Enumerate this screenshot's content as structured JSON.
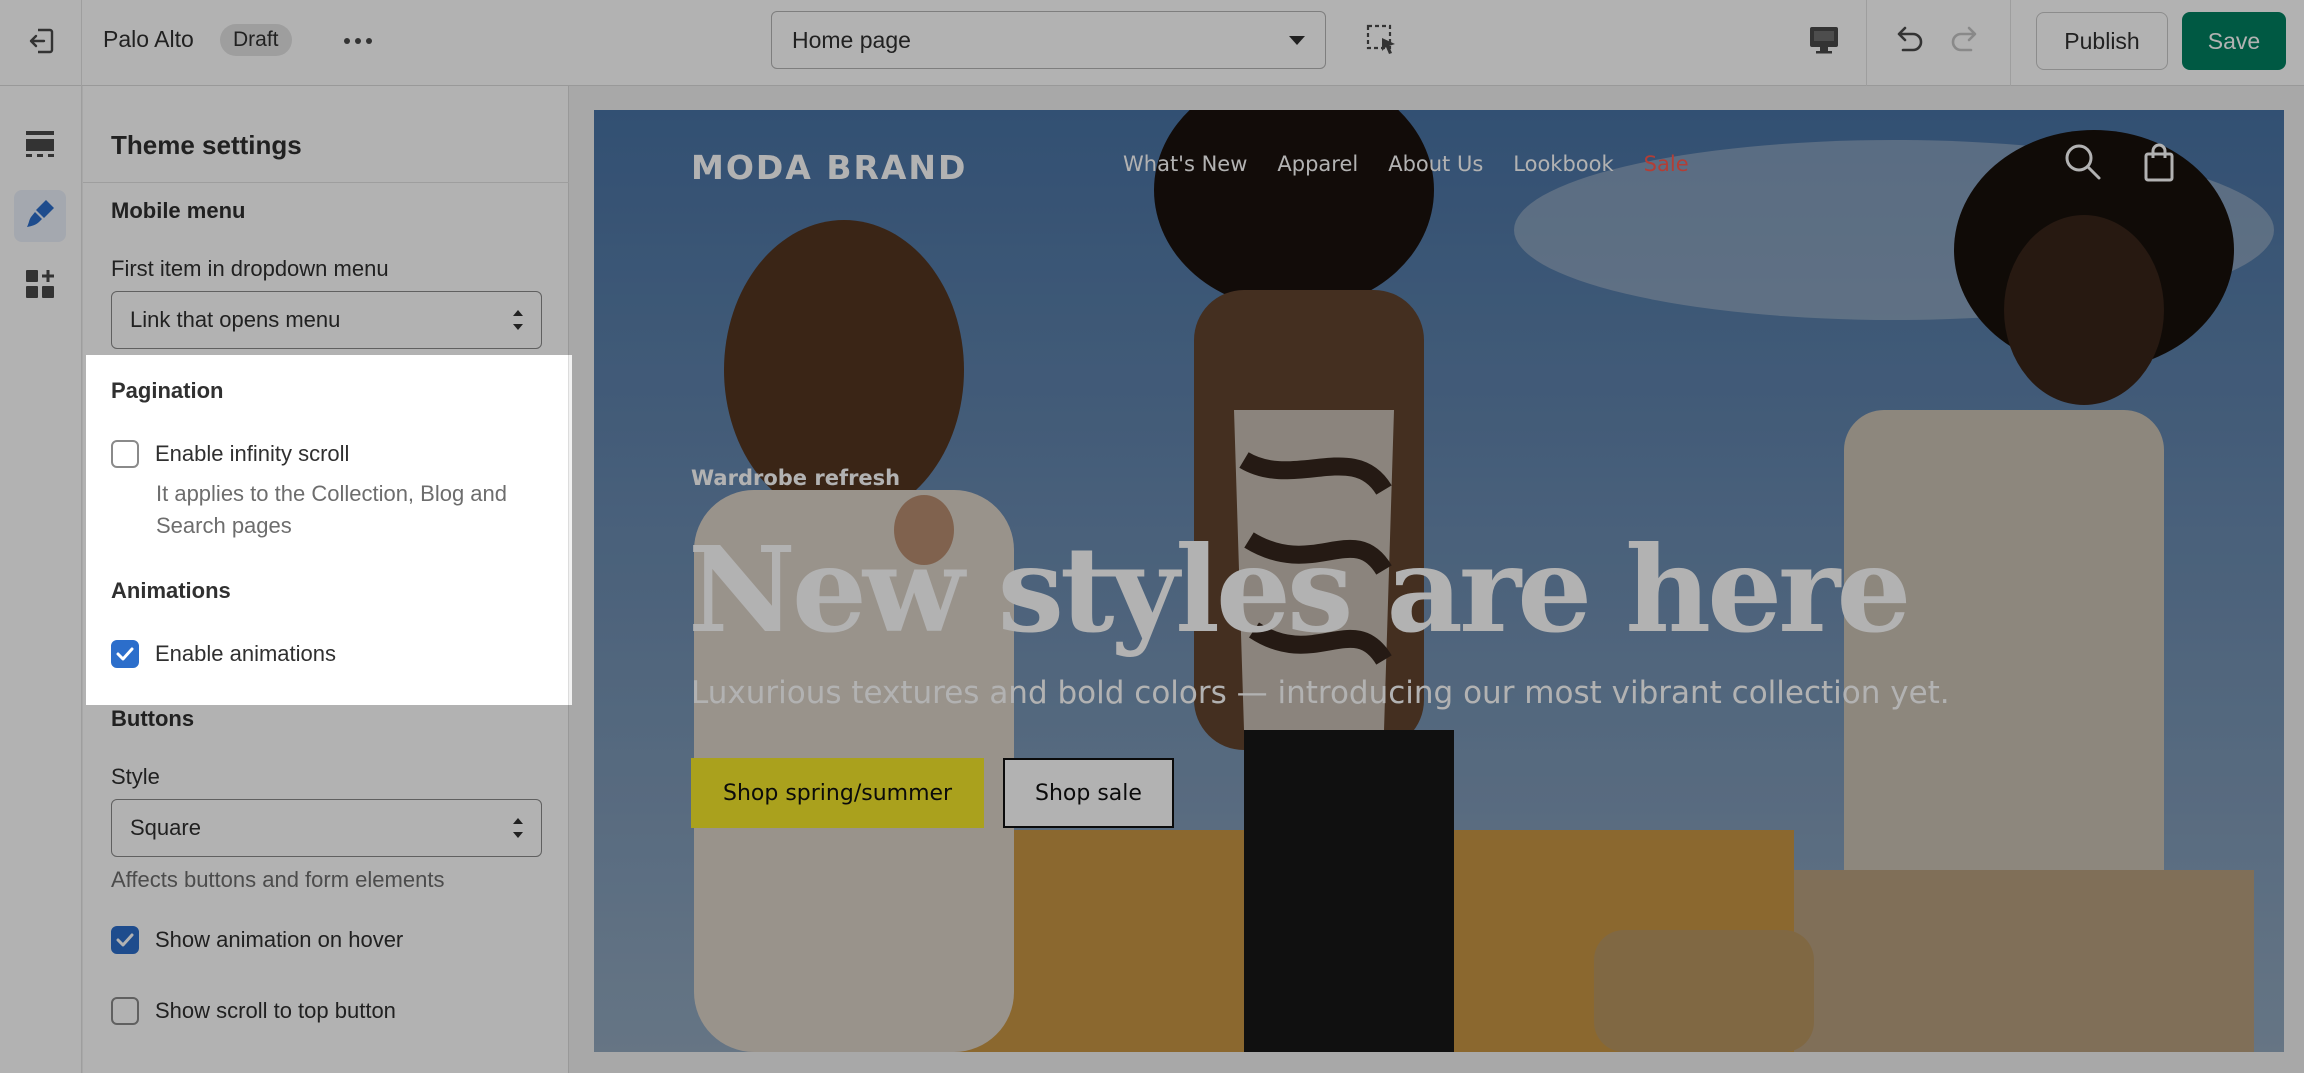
{
  "topbar": {
    "store_name": "Palo Alto",
    "status_badge": "Draft",
    "page_select_value": "Home page",
    "publish_label": "Publish",
    "save_label": "Save",
    "icons": [
      "exit-icon",
      "more-horizontal-icon",
      "inspector-icon",
      "desktop-icon",
      "undo-icon",
      "redo-icon"
    ]
  },
  "rail": {
    "items": [
      {
        "name": "sections-icon",
        "active": false
      },
      {
        "name": "theme-settings-icon",
        "active": true
      },
      {
        "name": "apps-icon",
        "active": false
      }
    ]
  },
  "panel": {
    "title": "Theme settings",
    "mobile_menu": {
      "heading": "Mobile menu",
      "field_label": "First item in dropdown menu",
      "select_value": "Link that opens menu"
    },
    "pagination": {
      "heading": "Pagination",
      "infinity_scroll_label": "Enable infinity scroll",
      "infinity_scroll_checked": false,
      "help_line1": "It applies to the Collection, Blog and",
      "help_line2": "Search pages"
    },
    "animations": {
      "heading": "Animations",
      "enable_label": "Enable animations",
      "enable_checked": true
    },
    "buttons": {
      "heading": "Buttons",
      "style_label": "Style",
      "style_value": "Square",
      "style_help": "Affects buttons and form elements",
      "hover_label": "Show animation on hover",
      "hover_checked": true,
      "scroll_top_label": "Show scroll to top button",
      "scroll_top_checked": false
    }
  },
  "preview": {
    "logo": "MODA BRAND",
    "nav": [
      "What's New",
      "Apparel",
      "About Us",
      "Lookbook",
      "Sale"
    ],
    "eyebrow": "Wardrobe refresh",
    "headline": "New styles are here",
    "subhead": "Luxurious textures and bold colors — introducing our most vibrant collection yet.",
    "cta_primary": "Shop spring/summer",
    "cta_secondary": "Shop sale",
    "colors": {
      "sale": "#ff5a4e",
      "cta_primary_bg": "#f4e72a",
      "save_bg": "#008060",
      "checkbox": "#2c6ecb"
    }
  }
}
